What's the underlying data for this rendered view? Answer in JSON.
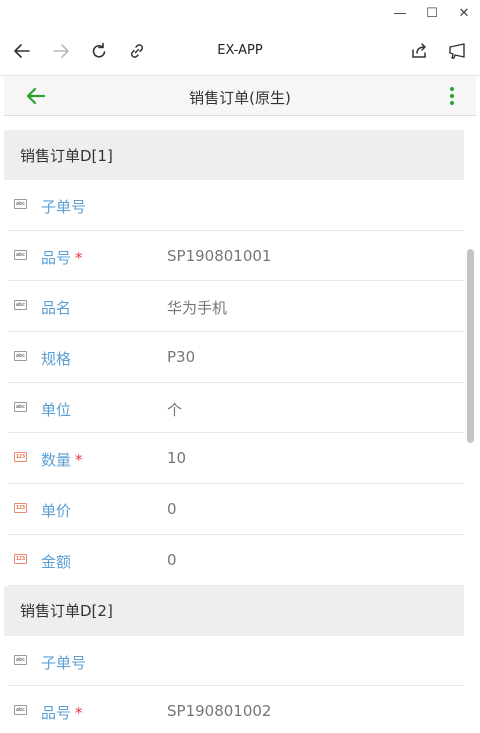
{
  "window": {
    "minimize_glyph": "—",
    "maximize_glyph": "☐",
    "close_glyph": "✕"
  },
  "browser": {
    "app_name": "EX-APP",
    "icons": [
      "back-arrow-icon",
      "forward-arrow-icon",
      "reload-icon",
      "link-icon",
      "share-icon",
      "cast-icon"
    ]
  },
  "appbar": {
    "title": "销售订单(原生)",
    "accent_color": "#2aa52a"
  },
  "colors": {
    "label": "#5b9fd4",
    "required": "#e53935",
    "value": "#777777",
    "section_bg": "#eeeeee",
    "number_icon": "#e0603f"
  },
  "sections": [
    {
      "title": "销售订单D[1]",
      "fields": [
        {
          "label": "子单号",
          "required": false,
          "value": "",
          "type": "text"
        },
        {
          "label": "品号",
          "required": true,
          "value": "SP190801001",
          "type": "text"
        },
        {
          "label": "品名",
          "required": false,
          "value": "华为手机",
          "type": "text"
        },
        {
          "label": "规格",
          "required": false,
          "value": "P30",
          "type": "text"
        },
        {
          "label": "单位",
          "required": false,
          "value": "个",
          "type": "text"
        },
        {
          "label": "数量",
          "required": true,
          "value": "10",
          "type": "number"
        },
        {
          "label": "单价",
          "required": false,
          "value": "0",
          "type": "number"
        },
        {
          "label": "金额",
          "required": false,
          "value": "0",
          "type": "number"
        }
      ]
    },
    {
      "title": "销售订单D[2]",
      "fields": [
        {
          "label": "子单号",
          "required": false,
          "value": "",
          "type": "text"
        },
        {
          "label": "品号",
          "required": true,
          "value": "SP190801002",
          "type": "text"
        }
      ]
    }
  ],
  "icon_text": {
    "text": "abc",
    "number": "123"
  },
  "required_mark": "*"
}
